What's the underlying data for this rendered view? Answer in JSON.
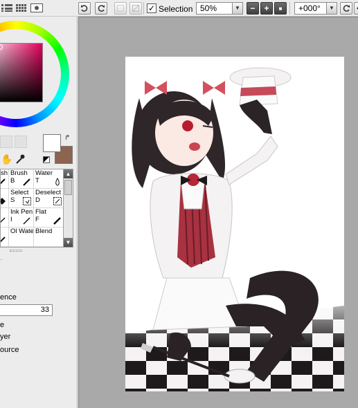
{
  "toolbar": {
    "undo_icon": "undo-icon",
    "redo_icon": "redo-icon",
    "selection_checked": true,
    "selection_label": "Selection",
    "zoom_value": "50%",
    "zoom_out_label": "−",
    "zoom_in_label": "+",
    "zoom_reset_label": "■",
    "rotation_value": "+000°",
    "rotate_reset_icon": "rotate-reset-icon",
    "flip_icon": "flip-icon"
  },
  "color": {
    "foreground": "#ffffff",
    "background": "#8c6450",
    "hue_accent": "#e0005a"
  },
  "tools": [
    {
      "name": "sh",
      "key": "",
      "icon": "brush-icon"
    },
    {
      "name": "Brush",
      "key": "B",
      "icon": "brush-icon"
    },
    {
      "name": "Water",
      "key": "T",
      "icon": "water-brush-icon"
    },
    {
      "name": "",
      "key": "",
      "icon": "diamond-icon"
    },
    {
      "name": "Select",
      "key": "S",
      "icon": "select-icon"
    },
    {
      "name": "Deselect",
      "key": "D",
      "icon": "deselect-icon"
    },
    {
      "name": "",
      "key": "",
      "icon": "pen-icon"
    },
    {
      "name": "Ink Pen",
      "key": "I",
      "icon": "ink-pen-icon"
    },
    {
      "name": "Flat",
      "key": "F",
      "icon": "flat-brush-icon"
    },
    {
      "name": "",
      "key": "",
      "icon": "brush-icon"
    },
    {
      "name": "Ol Wate",
      "key": "",
      "icon": "oil-water-icon"
    },
    {
      "name": "Blend",
      "key": "",
      "icon": "blend-icon"
    }
  ],
  "layer_panel": {
    "mode_label": "ence",
    "opacity_value": "33",
    "option_1": "e",
    "option_2": "yer",
    "option_3": "ource"
  }
}
